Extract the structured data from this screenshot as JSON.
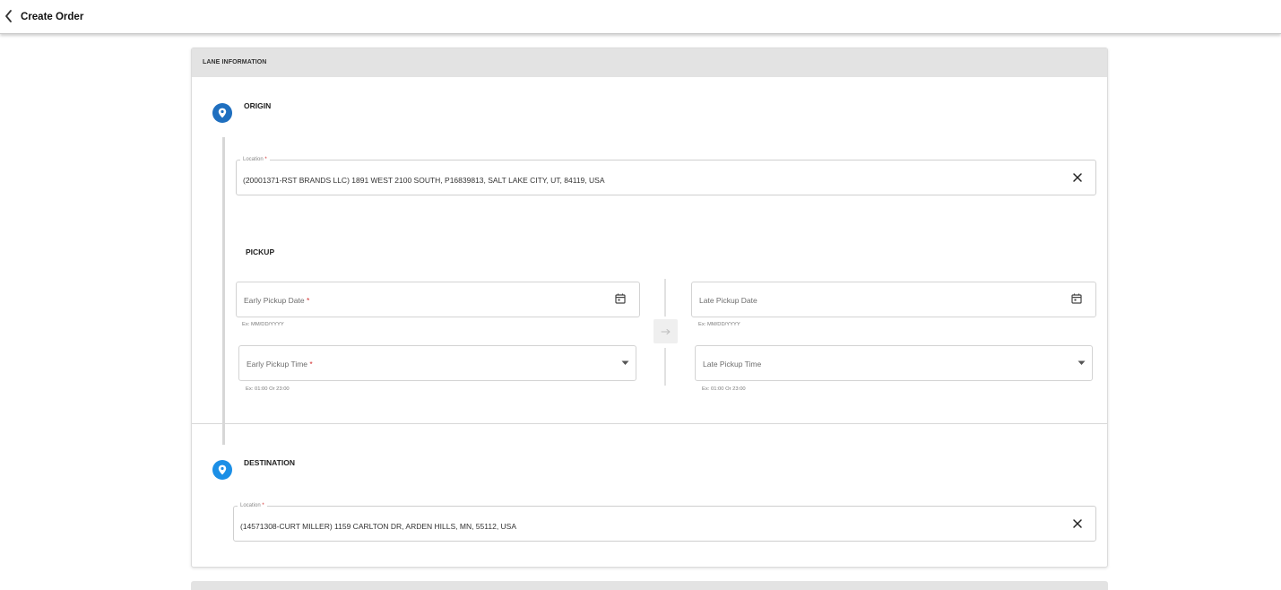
{
  "header": {
    "title": "Create Order",
    "back_icon": "chevron-left-icon"
  },
  "lane": {
    "section_title": "LANE INFORMATION",
    "origin": {
      "title": "ORIGIN",
      "icon": "location-pin-icon",
      "icon_color": "#1f6fbf",
      "location": {
        "label": "Location",
        "required_mark": "*",
        "value": "(20001371-RST BRANDS LLC) 1891 WEST 2100 SOUTH, P16839813, SALT LAKE CITY, UT, 84119, USA"
      }
    },
    "pickup": {
      "title": "PICKUP",
      "early_date": {
        "placeholder": "Early Pickup Date",
        "required_mark": "*",
        "hint": "Ex: MM/DD/YYYY"
      },
      "late_date": {
        "placeholder": "Late Pickup Date",
        "hint": "Ex: MM/DD/YYYY"
      },
      "early_time": {
        "placeholder": "Early Pickup Time",
        "required_mark": "*",
        "hint": "Ex: 01:00 Or 23:00"
      },
      "late_time": {
        "placeholder": "Late Pickup Time",
        "hint": "Ex: 01:00 Or 23:00"
      }
    },
    "destination": {
      "title": "DESTINATION",
      "icon": "location-pin-icon",
      "icon_color": "#1c8fe6",
      "location": {
        "label": "Location",
        "required_mark": "*",
        "value": "(14571308-CURT MILLER) 1159 CARLTON DR, ARDEN HILLS, MN, 55112, USA"
      }
    }
  },
  "colors": {
    "accent_origin": "#1f6fbf",
    "accent_destination": "#1c8fe6",
    "required": "#d32f2f",
    "header_bg": "#e3e3e3"
  }
}
